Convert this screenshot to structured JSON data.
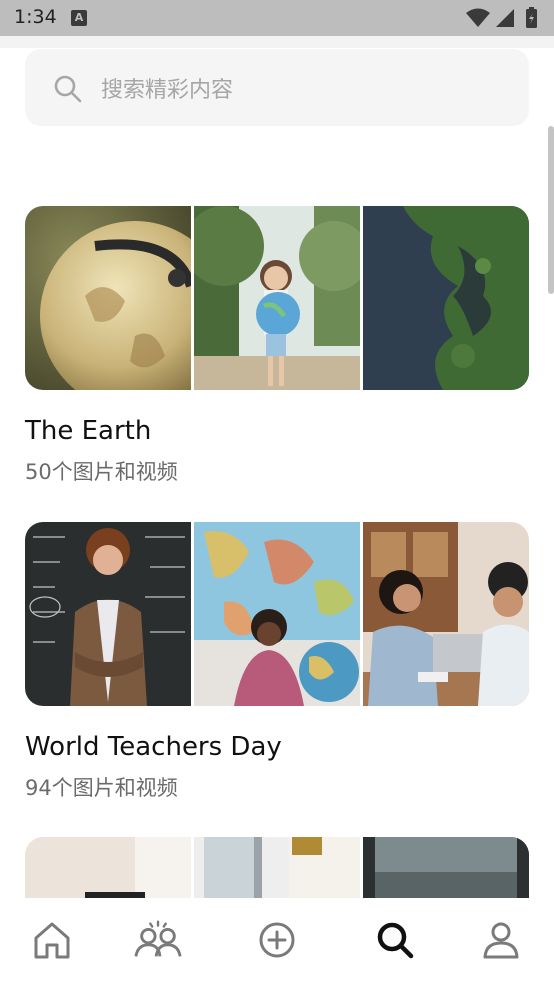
{
  "status_bar": {
    "time": "1:34",
    "notification_glyph": "A"
  },
  "search": {
    "placeholder": "搜索精彩内容",
    "icon": "search-icon"
  },
  "collections": [
    {
      "title": "The Earth",
      "count": "50个图片和视频",
      "thumbnails": [
        "globe-photo",
        "girl-holding-globe-photo",
        "satellite-island-photo"
      ]
    },
    {
      "title": "World Teachers Day",
      "count": "94个图片和视频",
      "thumbnails": [
        "teacher-chalkboard-photo",
        "student-world-map-photo",
        "people-laptop-photo"
      ]
    },
    {
      "title": "",
      "count": "",
      "thumbnails": [
        "room-photo",
        "window-photo",
        "sea-window-photo"
      ]
    }
  ],
  "bottom_nav": {
    "items": [
      {
        "name": "home",
        "icon": "home-icon",
        "active": false
      },
      {
        "name": "community",
        "icon": "people-icon",
        "active": false
      },
      {
        "name": "upload",
        "icon": "plus-circle-icon",
        "active": false
      },
      {
        "name": "search",
        "icon": "search-icon",
        "active": true
      },
      {
        "name": "profile",
        "icon": "user-icon",
        "active": false
      }
    ]
  },
  "colors": {
    "status_bar": "#bdbdbd",
    "search_bg": "#f5f5f5",
    "text": "#111111",
    "secondary_text": "#6b6b6b",
    "nav_icon": "#7a7a7a",
    "nav_icon_active": "#111111"
  }
}
